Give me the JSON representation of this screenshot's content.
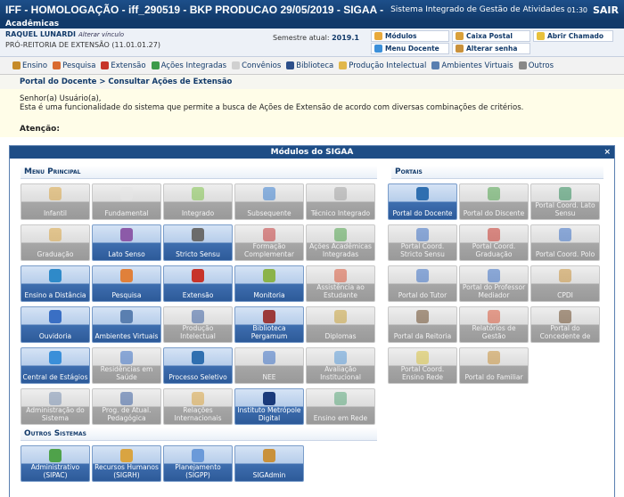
{
  "header": {
    "title": "IFF - HOMOLOGAÇÃO - iff_290519 - BKP PRODUCAO 29/05/2019 - SIGAA -",
    "system": "Sistema Integrado de Gestão de Atividades Acadêmicas",
    "clock": "01:30",
    "exit": "SAIR",
    "subtitle": "Acadêmicas"
  },
  "user": {
    "name": "RAQUEL LUNARDI",
    "change_link": "Alterar vínculo",
    "unit": "PRÓ-REITORIA DE EXTENSÃO (11.01.01.27)",
    "semester_label": "Semestre atual:",
    "semester_value": "2019.1",
    "links": [
      {
        "label": "Módulos",
        "color": "#e8a93b"
      },
      {
        "label": "Caixa Postal",
        "color": "#d9a03a"
      },
      {
        "label": "Abrir Chamado",
        "color": "#e8c13b"
      },
      {
        "label": "Menu Docente",
        "color": "#3b8fd9"
      },
      {
        "label": "Alterar senha",
        "color": "#c9913b"
      }
    ]
  },
  "menu": [
    {
      "label": "Ensino",
      "color": "#c68b2a"
    },
    {
      "label": "Pesquisa",
      "color": "#d96a2f"
    },
    {
      "label": "Extensão",
      "color": "#c7342a"
    },
    {
      "label": "Ações Integradas",
      "color": "#3d9a4a"
    },
    {
      "label": "Convênios",
      "color": "#d0d0d0"
    },
    {
      "label": "Biblioteca",
      "color": "#2d4f8a"
    },
    {
      "label": "Produção Intelectual",
      "color": "#e1b74a"
    },
    {
      "label": "Ambientes Virtuais",
      "color": "#5a7fb0"
    },
    {
      "label": "Outros",
      "color": "#888"
    }
  ],
  "breadcrumb": "Portal do Docente > Consultar Ações de Extensão",
  "content": {
    "line1": "Senhor(a) Usuário(a),",
    "line2": "Esta é uma funcionalidade do sistema que permite a busca de Ações de Extensão de acordo com diversas combinações de critérios.",
    "attention": "Atenção:"
  },
  "modal": {
    "title": "Módulos do SIGAA",
    "close": "×",
    "main_menu_title": "Menu Principal",
    "portals_title": "Portais",
    "other_systems_title": "Outros Sistemas",
    "main_menu": [
      {
        "label": "Infantil",
        "on": false,
        "color": "#d9a441"
      },
      {
        "label": "Fundamental",
        "on": false,
        "color": "#e6e6e6"
      },
      {
        "label": "Integrado",
        "on": false,
        "color": "#7fc24b"
      },
      {
        "label": "Subsequente",
        "on": false,
        "color": "#3a7fd1"
      },
      {
        "label": "Técnico Integrado",
        "on": false,
        "color": "#a3a3a3"
      },
      {
        "label": "Graduação",
        "on": false,
        "color": "#d9a441"
      },
      {
        "label": "Lato Senso",
        "on": true,
        "color": "#8c5aa8"
      },
      {
        "label": "Stricto Sensu",
        "on": true,
        "color": "#6b6b6b"
      },
      {
        "label": "Formação Complementar",
        "on": false,
        "color": "#c43b3b"
      },
      {
        "label": "Ações Acadêmicas Integradas",
        "on": false,
        "color": "#4fa24a"
      },
      {
        "label": "Ensino a Distância",
        "on": true,
        "color": "#2f8ac9"
      },
      {
        "label": "Pesquisa",
        "on": true,
        "color": "#e0803a"
      },
      {
        "label": "Extensão",
        "on": true,
        "color": "#c7342a"
      },
      {
        "label": "Monitoria",
        "on": true,
        "color": "#8bb34a"
      },
      {
        "label": "Assistência ao Estudante",
        "on": false,
        "color": "#d9583a"
      },
      {
        "label": "Ouvidoria",
        "on": true,
        "color": "#3a6fc4"
      },
      {
        "label": "Ambientes Virtuais",
        "on": true,
        "color": "#5a7fb0"
      },
      {
        "label": "Produção Intelectual",
        "on": false,
        "color": "#3a5fa0"
      },
      {
        "label": "Biblioteca Pergamum",
        "on": true,
        "color": "#9b3a3a"
      },
      {
        "label": "Diplomas",
        "on": false,
        "color": "#c9a23a"
      },
      {
        "label": "Central de Estágios",
        "on": true,
        "color": "#3a8fd9"
      },
      {
        "label": "Residências em Saúde",
        "on": false,
        "color": "#3a6fc4"
      },
      {
        "label": "Processo Seletivo",
        "on": true,
        "color": "#2f6fb0"
      },
      {
        "label": "NEE",
        "on": false,
        "color": "#3a6fc4"
      },
      {
        "label": "Avaliação Institucional",
        "on": false,
        "color": "#5a9ad9"
      },
      {
        "label": "Administração do Sistema",
        "on": false,
        "color": "#7a8fb0"
      },
      {
        "label": "Prog. de Atual. Pedagógica",
        "on": false,
        "color": "#3a5fa0"
      },
      {
        "label": "Relações Internacionais",
        "on": false,
        "color": "#d9a441"
      },
      {
        "label": "Instituto Metrópole Digital",
        "on": true,
        "color": "#1a3a7a"
      },
      {
        "label": "Ensino em Rede",
        "on": false,
        "color": "#5aa87a"
      }
    ],
    "portals": [
      {
        "label": "Portal do Docente",
        "on": true,
        "color": "#2f6fb0"
      },
      {
        "label": "Portal do Discente",
        "on": false,
        "color": "#4fa24a"
      },
      {
        "label": "Portal Coord. Lato Sensu",
        "on": false,
        "color": "#2e8b57"
      },
      {
        "label": "Portal Coord. Stricto Sensu",
        "on": false,
        "color": "#3a6fc4"
      },
      {
        "label": "Portal Coord. Graduação",
        "on": false,
        "color": "#c7342a"
      },
      {
        "label": "Portal Coord. Polo",
        "on": false,
        "color": "#3a6fc4"
      },
      {
        "label": "Portal do Tutor",
        "on": false,
        "color": "#3a6fc4"
      },
      {
        "label": "Portal do Professor Mediador",
        "on": false,
        "color": "#3a6fc4"
      },
      {
        "label": "CPDI",
        "on": false,
        "color": "#c9913b"
      },
      {
        "label": "Portal da Reitoria",
        "on": false,
        "color": "#6b4a2a"
      },
      {
        "label": "Relatórios de Gestão",
        "on": false,
        "color": "#d9583a"
      },
      {
        "label": "Portal do Concedente de",
        "on": false,
        "color": "#6b4a2a"
      },
      {
        "label": "Portal Coord. Ensino Rede",
        "on": false,
        "color": "#d9c241"
      },
      {
        "label": "Portal do Familiar",
        "on": false,
        "color": "#c9913b"
      }
    ],
    "other_systems": [
      {
        "label": "Administrativo (SIPAC)",
        "on": true,
        "color": "#4fa24a"
      },
      {
        "label": "Recursos Humanos (SIGRH)",
        "on": true,
        "color": "#d9a441"
      },
      {
        "label": "Planejamento (SIGPP)",
        "on": true,
        "color": "#6b9ad9"
      },
      {
        "label": "SIGAdmin",
        "on": true,
        "color": "#c9913b"
      }
    ]
  }
}
